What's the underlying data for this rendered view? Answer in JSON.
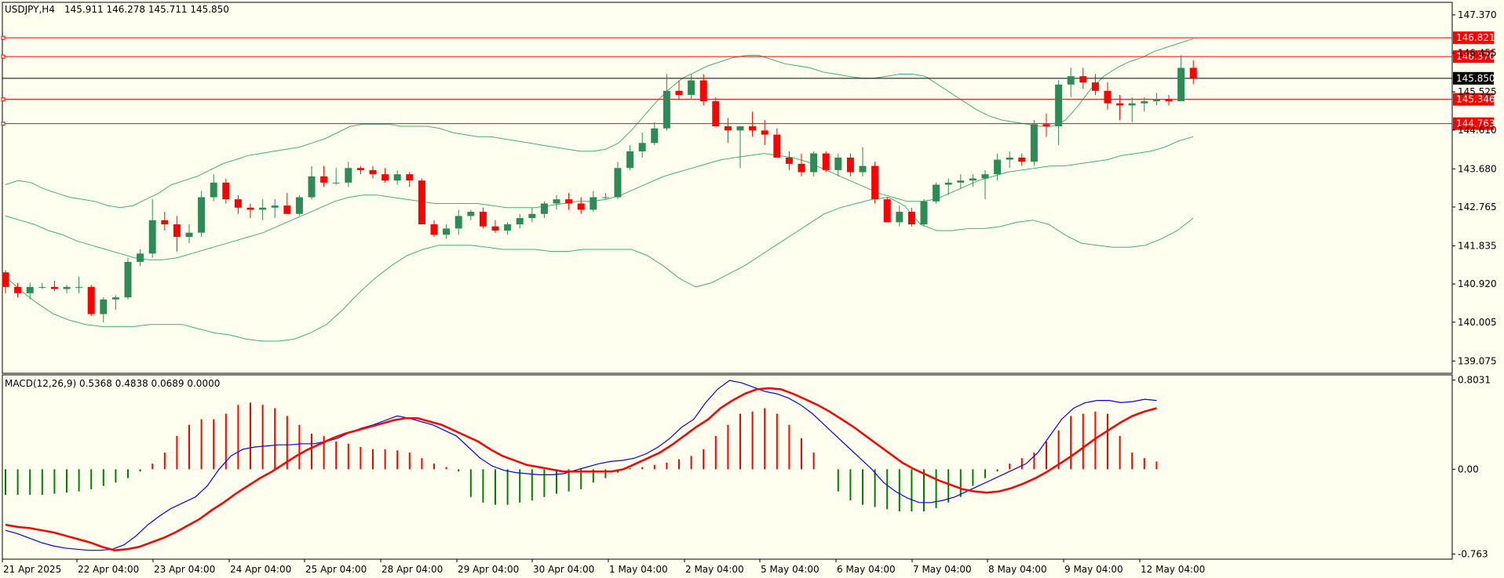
{
  "header": {
    "symbol": "USDJPY,H4",
    "ohlc": "145.911 146.278 145.711 145.850",
    "macd_label": "MACD(12,26,9) 0.5368 0.4838 0.0689 0.0000"
  },
  "colors": {
    "background": "#fffff0",
    "bull": "#2e8b57",
    "bear": "#ff0000",
    "bands": "#3cb371",
    "level": "#ff0000",
    "current_price_line": "#000000",
    "macd_line": "#0000ff",
    "signal_line": "#ff0000",
    "hist_pos": "#ff0000",
    "hist_neg": "#008000"
  },
  "chart_data": {
    "type": "candlestick",
    "price_axis": {
      "range": [
        138.78,
        147.67
      ],
      "ticks": [
        "147.370",
        "146.455",
        "145.525",
        "144.610",
        "143.680",
        "142.765",
        "141.835",
        "140.920",
        "140.005",
        "139.075"
      ]
    },
    "macd_axis": {
      "range": [
        -0.81,
        0.85
      ],
      "ticks": [
        "0.8031",
        "0.00",
        "-0.763"
      ]
    },
    "x_axis_labels": [
      "21 Apr 2025",
      "22 Apr 04:00",
      "23 Apr 04:00",
      "24 Apr 04:00",
      "25 Apr 04:00",
      "28 Apr 04:00",
      "29 Apr 04:00",
      "30 Apr 04:00",
      "1 May 04:00",
      "2 May 04:00",
      "5 May 04:00",
      "6 May 04:00",
      "7 May 04:00",
      "8 May 04:00",
      "9 May 04:00",
      "12 May 04:00"
    ],
    "levels": [
      {
        "price": 146.821,
        "label": "146.821"
      },
      {
        "price": 146.37,
        "label": "146.370"
      },
      {
        "price": 145.346,
        "label": "145.346"
      },
      {
        "price": 144.763,
        "label": "144.763"
      }
    ],
    "current_price": {
      "price": 145.85,
      "label": "145.850"
    },
    "candles": [
      [
        141.2,
        141.25,
        140.7,
        140.85
      ],
      [
        140.85,
        140.95,
        140.6,
        140.7
      ],
      [
        140.7,
        140.95,
        140.55,
        140.85
      ],
      [
        140.85,
        140.95,
        140.8,
        140.85
      ],
      [
        140.85,
        141.0,
        140.75,
        140.8
      ],
      [
        140.8,
        140.9,
        140.7,
        140.85
      ],
      [
        140.85,
        141.1,
        140.7,
        140.85
      ],
      [
        140.85,
        140.9,
        140.15,
        140.2
      ],
      [
        140.2,
        140.6,
        140.0,
        140.55
      ],
      [
        140.55,
        140.65,
        140.3,
        140.6
      ],
      [
        140.6,
        141.55,
        140.55,
        141.45
      ],
      [
        141.45,
        141.75,
        141.35,
        141.65
      ],
      [
        141.65,
        142.95,
        141.55,
        142.45
      ],
      [
        142.45,
        142.65,
        142.2,
        142.35
      ],
      [
        142.35,
        142.55,
        141.7,
        142.05
      ],
      [
        142.05,
        142.35,
        141.9,
        142.15
      ],
      [
        142.15,
        143.15,
        142.05,
        143.0
      ],
      [
        143.0,
        143.55,
        142.9,
        143.35
      ],
      [
        143.35,
        143.45,
        142.85,
        142.95
      ],
      [
        142.95,
        143.05,
        142.6,
        142.75
      ],
      [
        142.75,
        142.85,
        142.5,
        142.7
      ],
      [
        142.7,
        142.95,
        142.45,
        142.75
      ],
      [
        142.75,
        142.95,
        142.5,
        142.8
      ],
      [
        142.8,
        143.1,
        142.6,
        142.6
      ],
      [
        142.6,
        143.05,
        142.55,
        143.0
      ],
      [
        143.0,
        143.75,
        142.95,
        143.5
      ],
      [
        143.5,
        143.75,
        143.25,
        143.35
      ],
      [
        143.35,
        143.7,
        143.3,
        143.35
      ],
      [
        143.35,
        143.85,
        143.25,
        143.7
      ],
      [
        143.7,
        143.75,
        143.55,
        143.65
      ],
      [
        143.65,
        143.75,
        143.45,
        143.55
      ],
      [
        143.55,
        143.7,
        143.35,
        143.4
      ],
      [
        143.4,
        143.65,
        143.3,
        143.55
      ],
      [
        143.55,
        143.6,
        143.25,
        143.4
      ],
      [
        143.4,
        143.45,
        142.35,
        142.35
      ],
      [
        142.35,
        142.45,
        142.05,
        142.1
      ],
      [
        142.1,
        142.35,
        142.0,
        142.25
      ],
      [
        142.25,
        142.7,
        142.1,
        142.55
      ],
      [
        142.55,
        142.7,
        142.45,
        142.65
      ],
      [
        142.65,
        142.75,
        142.25,
        142.3
      ],
      [
        142.3,
        142.45,
        142.15,
        142.2
      ],
      [
        142.2,
        142.4,
        142.1,
        142.35
      ],
      [
        142.35,
        142.6,
        142.25,
        142.5
      ],
      [
        142.5,
        142.75,
        142.4,
        142.6
      ],
      [
        142.6,
        142.9,
        142.5,
        142.85
      ],
      [
        142.85,
        143.05,
        142.7,
        142.95
      ],
      [
        142.95,
        143.1,
        142.7,
        142.85
      ],
      [
        142.85,
        143.0,
        142.6,
        142.7
      ],
      [
        142.7,
        143.15,
        142.65,
        143.0
      ],
      [
        143.0,
        143.1,
        142.95,
        143.0
      ],
      [
        143.0,
        143.85,
        142.95,
        143.7
      ],
      [
        143.7,
        144.25,
        143.65,
        144.1
      ],
      [
        144.1,
        144.55,
        143.95,
        144.3
      ],
      [
        144.3,
        144.8,
        144.25,
        144.65
      ],
      [
        144.65,
        145.95,
        144.6,
        145.55
      ],
      [
        145.55,
        145.8,
        145.35,
        145.45
      ],
      [
        145.45,
        145.95,
        145.35,
        145.8
      ],
      [
        145.8,
        145.95,
        145.2,
        145.3
      ],
      [
        145.3,
        145.4,
        144.7,
        144.7
      ],
      [
        144.7,
        144.9,
        144.3,
        144.6
      ],
      [
        144.6,
        144.7,
        143.7,
        144.7
      ],
      [
        144.7,
        145.05,
        144.45,
        144.6
      ],
      [
        144.6,
        144.85,
        144.25,
        144.5
      ],
      [
        144.5,
        144.65,
        143.95,
        143.95
      ],
      [
        143.95,
        144.1,
        143.65,
        143.8
      ],
      [
        143.8,
        144.05,
        143.5,
        143.6
      ],
      [
        143.6,
        144.1,
        143.5,
        144.05
      ],
      [
        144.05,
        144.1,
        143.6,
        143.65
      ],
      [
        143.65,
        144.05,
        143.5,
        143.95
      ],
      [
        143.95,
        144.05,
        143.5,
        143.6
      ],
      [
        143.6,
        144.2,
        143.5,
        143.75
      ],
      [
        143.75,
        143.85,
        142.85,
        142.95
      ],
      [
        142.95,
        143.0,
        142.4,
        142.4
      ],
      [
        142.4,
        142.8,
        142.3,
        142.65
      ],
      [
        142.65,
        142.75,
        142.3,
        142.35
      ],
      [
        142.35,
        142.95,
        142.3,
        142.9
      ],
      [
        142.9,
        143.35,
        142.85,
        143.3
      ],
      [
        143.3,
        143.45,
        143.05,
        143.35
      ],
      [
        143.35,
        143.55,
        143.2,
        143.4
      ],
      [
        143.4,
        143.55,
        143.25,
        143.45
      ],
      [
        143.45,
        143.65,
        142.95,
        143.55
      ],
      [
        143.55,
        144.05,
        143.4,
        143.9
      ],
      [
        143.9,
        144.1,
        143.7,
        143.95
      ],
      [
        143.95,
        144.05,
        143.75,
        143.85
      ],
      [
        143.85,
        144.85,
        143.75,
        144.75
      ],
      [
        144.75,
        145.0,
        144.45,
        144.7
      ],
      [
        144.7,
        145.8,
        144.25,
        145.7
      ],
      [
        145.7,
        146.1,
        145.4,
        145.9
      ],
      [
        145.9,
        146.1,
        145.6,
        145.75
      ],
      [
        145.75,
        145.95,
        145.45,
        145.55
      ],
      [
        145.55,
        145.75,
        145.1,
        145.25
      ],
      [
        145.25,
        145.45,
        144.85,
        145.2
      ],
      [
        145.2,
        145.4,
        144.8,
        145.25
      ],
      [
        145.25,
        145.4,
        145.05,
        145.3
      ],
      [
        145.3,
        145.5,
        145.2,
        145.35
      ],
      [
        145.35,
        145.45,
        145.2,
        145.3
      ],
      [
        145.3,
        146.4,
        145.8,
        146.1
      ],
      [
        146.1,
        146.28,
        145.71,
        145.85
      ]
    ],
    "bands": {
      "upper": [
        143.3,
        143.4,
        143.35,
        143.2,
        143.1,
        143.0,
        142.95,
        142.9,
        142.8,
        142.75,
        142.8,
        142.95,
        143.1,
        143.3,
        143.4,
        143.5,
        143.65,
        143.8,
        143.9,
        144.0,
        144.05,
        144.1,
        144.15,
        144.2,
        144.3,
        144.4,
        144.55,
        144.7,
        144.75,
        144.75,
        144.75,
        144.7,
        144.7,
        144.7,
        144.65,
        144.55,
        144.5,
        144.45,
        144.45,
        144.4,
        144.35,
        144.3,
        144.25,
        144.2,
        144.15,
        144.1,
        144.1,
        144.15,
        144.3,
        144.6,
        144.95,
        145.3,
        145.6,
        145.85,
        146.0,
        146.15,
        146.25,
        146.35,
        146.4,
        146.4,
        146.3,
        146.2,
        146.15,
        146.1,
        146.0,
        145.95,
        145.9,
        145.85,
        145.85,
        145.9,
        145.95,
        145.95,
        145.9,
        145.7,
        145.5,
        145.3,
        145.1,
        144.95,
        144.85,
        144.8,
        144.75,
        144.7,
        144.7,
        144.85,
        145.2,
        145.6,
        145.9,
        146.1,
        146.25,
        146.35,
        146.5,
        146.6,
        146.7,
        146.8
      ],
      "middle": [
        142.55,
        142.45,
        142.35,
        142.2,
        142.1,
        141.95,
        141.85,
        141.75,
        141.65,
        141.55,
        141.5,
        141.5,
        141.55,
        141.65,
        141.75,
        141.85,
        141.95,
        142.05,
        142.15,
        142.3,
        142.45,
        142.6,
        142.75,
        142.9,
        143.0,
        143.05,
        143.05,
        143.0,
        142.95,
        142.9,
        142.85,
        142.85,
        142.85,
        142.85,
        142.8,
        142.75,
        142.75,
        142.75,
        142.8,
        142.85,
        142.9,
        142.9,
        142.95,
        143.05,
        143.2,
        143.35,
        143.5,
        143.6,
        143.7,
        143.8,
        143.9,
        143.95,
        144.0,
        144.05,
        144.0,
        143.95,
        143.85,
        143.7,
        143.55,
        143.4,
        143.25,
        143.1,
        143.0,
        142.9,
        142.9,
        142.95,
        143.1,
        143.25,
        143.4,
        143.5,
        143.6,
        143.65,
        143.7,
        143.75,
        143.75,
        143.8,
        143.85,
        143.9,
        144.0,
        144.05,
        144.1,
        144.2,
        144.35,
        144.45
      ],
      "lower": [
        141.1,
        140.75,
        140.45,
        140.2,
        140.05,
        139.95,
        139.9,
        139.9,
        139.9,
        139.95,
        139.95,
        139.95,
        139.85,
        139.75,
        139.7,
        139.6,
        139.55,
        139.55,
        139.6,
        139.75,
        139.95,
        140.3,
        140.7,
        141.05,
        141.35,
        141.6,
        141.75,
        141.85,
        141.85,
        141.85,
        141.8,
        141.75,
        141.75,
        141.75,
        141.7,
        141.7,
        141.75,
        141.75,
        141.75,
        141.75,
        141.6,
        141.35,
        141.05,
        140.85,
        140.95,
        141.15,
        141.35,
        141.6,
        141.85,
        142.1,
        142.35,
        142.6,
        142.75,
        142.85,
        142.95,
        143.0,
        142.8,
        142.35,
        142.2,
        142.2,
        142.25,
        142.25,
        142.3,
        142.4,
        142.45,
        142.35,
        142.1,
        141.9,
        141.85,
        141.8,
        141.8,
        141.85,
        142.0,
        142.2,
        142.5
      ]
    },
    "macd_hist": [
      -0.23,
      -0.23,
      -0.23,
      -0.23,
      -0.22,
      -0.21,
      -0.2,
      -0.18,
      -0.15,
      -0.12,
      -0.08,
      -0.02,
      0.05,
      0.15,
      0.3,
      0.4,
      0.45,
      0.45,
      0.5,
      0.58,
      0.6,
      0.58,
      0.55,
      0.48,
      0.4,
      0.32,
      0.3,
      0.25,
      0.23,
      0.2,
      0.18,
      0.18,
      0.17,
      0.15,
      0.1,
      0.05,
      0.02,
      -0.02,
      -0.25,
      -0.3,
      -0.32,
      -0.32,
      -0.3,
      -0.28,
      -0.25,
      -0.22,
      -0.2,
      -0.18,
      -0.12,
      -0.08,
      -0.03,
      0.01,
      0.02,
      0.04,
      0.06,
      0.09,
      0.12,
      0.18,
      0.3,
      0.4,
      0.5,
      0.52,
      0.55,
      0.5,
      0.4,
      0.28,
      0.15,
      0.0,
      -0.2,
      -0.28,
      -0.32,
      -0.34,
      -0.36,
      -0.38,
      -0.38,
      -0.38,
      -0.35,
      -0.3,
      -0.25,
      -0.15,
      -0.08,
      -0.02,
      0.05,
      0.1,
      0.15,
      0.25,
      0.35,
      0.48,
      0.5,
      0.52,
      0.5,
      0.3,
      0.15,
      0.1,
      0.07
    ],
    "macd_line": [
      -0.55,
      -0.58,
      -0.62,
      -0.66,
      -0.69,
      -0.71,
      -0.72,
      -0.73,
      -0.73,
      -0.72,
      -0.68,
      -0.6,
      -0.5,
      -0.42,
      -0.35,
      -0.3,
      -0.25,
      -0.15,
      0.0,
      0.12,
      0.18,
      0.2,
      0.21,
      0.22,
      0.22,
      0.23,
      0.23,
      0.25,
      0.28,
      0.33,
      0.37,
      0.4,
      0.44,
      0.48,
      0.46,
      0.43,
      0.4,
      0.35,
      0.3,
      0.2,
      0.1,
      0.03,
      -0.01,
      -0.03,
      -0.04,
      -0.05,
      -0.05,
      -0.04,
      -0.01,
      0.02,
      0.05,
      0.07,
      0.08,
      0.1,
      0.14,
      0.2,
      0.28,
      0.38,
      0.45,
      0.6,
      0.72,
      0.8,
      0.78,
      0.74,
      0.7,
      0.68,
      0.64,
      0.58,
      0.5,
      0.4,
      0.3,
      0.2,
      0.1,
      0.0,
      -0.12,
      -0.2,
      -0.26,
      -0.3,
      -0.3,
      -0.28,
      -0.25,
      -0.2,
      -0.15,
      -0.1,
      -0.05,
      0.0,
      0.05,
      0.15,
      0.3,
      0.45,
      0.55,
      0.6,
      0.62,
      0.62,
      0.6,
      0.61,
      0.63,
      0.62
    ],
    "signal_line": [
      -0.5,
      -0.52,
      -0.53,
      -0.55,
      -0.57,
      -0.6,
      -0.63,
      -0.66,
      -0.7,
      -0.73,
      -0.72,
      -0.7,
      -0.66,
      -0.62,
      -0.57,
      -0.51,
      -0.45,
      -0.37,
      -0.3,
      -0.22,
      -0.15,
      -0.08,
      -0.02,
      0.05,
      0.12,
      0.18,
      0.23,
      0.28,
      0.32,
      0.35,
      0.38,
      0.41,
      0.44,
      0.46,
      0.46,
      0.43,
      0.4,
      0.35,
      0.3,
      0.25,
      0.18,
      0.12,
      0.08,
      0.04,
      0.02,
      0.0,
      -0.02,
      -0.02,
      -0.02,
      -0.02,
      -0.02,
      0.0,
      0.05,
      0.1,
      0.15,
      0.22,
      0.3,
      0.38,
      0.45,
      0.55,
      0.62,
      0.68,
      0.72,
      0.73,
      0.72,
      0.68,
      0.63,
      0.58,
      0.52,
      0.45,
      0.38,
      0.3,
      0.22,
      0.14,
      0.06,
      0.0,
      -0.05,
      -0.1,
      -0.14,
      -0.18,
      -0.2,
      -0.21,
      -0.2,
      -0.17,
      -0.13,
      -0.08,
      -0.02,
      0.05,
      0.12,
      0.2,
      0.28,
      0.35,
      0.42,
      0.48,
      0.52,
      0.55
    ]
  }
}
